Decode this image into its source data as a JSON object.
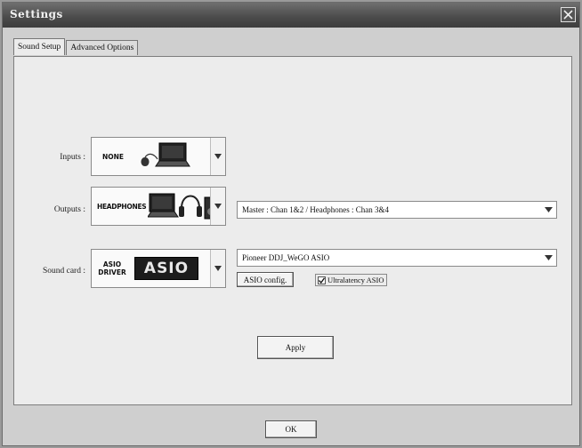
{
  "window": {
    "title": "Settings"
  },
  "tabs": [
    {
      "label": "Sound Setup",
      "active": true
    },
    {
      "label": "Advanced Options",
      "active": false
    }
  ],
  "inputs": {
    "label": "Inputs :",
    "selected": "NONE",
    "icon": "laptop-mouse-icon"
  },
  "outputs": {
    "label": "Outputs :",
    "selected": "HEADPHONES",
    "icon": "headphones-speaker-icon",
    "routing": "Master : Chan 1&2 / Headphones : Chan 3&4"
  },
  "soundcard": {
    "label": "Sound card :",
    "driver_line1": "ASIO",
    "driver_line2": "DRIVER",
    "logo_text": "ASIO",
    "device": "Pioneer DDJ_WeGO ASIO",
    "config_button": "ASIO config.",
    "ultralatency_label": "Ultralatency ASIO",
    "ultralatency_checked": true
  },
  "apply_button": "Apply",
  "ok_button": "OK"
}
